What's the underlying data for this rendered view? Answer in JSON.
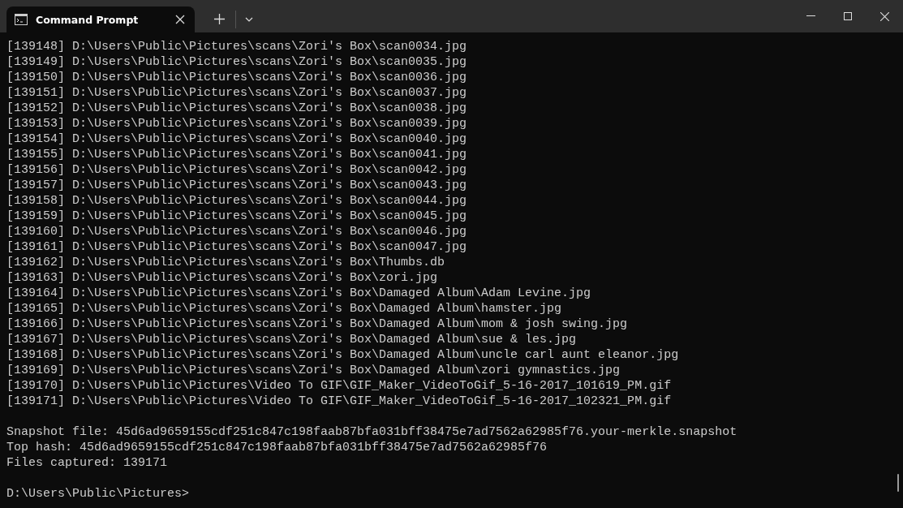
{
  "window": {
    "tabs": [
      {
        "title": "Command Prompt",
        "selected": true
      }
    ]
  },
  "terminal": {
    "listing": [
      "[139148] D:\\Users\\Public\\Pictures\\scans\\Zori's Box\\scan0034.jpg",
      "[139149] D:\\Users\\Public\\Pictures\\scans\\Zori's Box\\scan0035.jpg",
      "[139150] D:\\Users\\Public\\Pictures\\scans\\Zori's Box\\scan0036.jpg",
      "[139151] D:\\Users\\Public\\Pictures\\scans\\Zori's Box\\scan0037.jpg",
      "[139152] D:\\Users\\Public\\Pictures\\scans\\Zori's Box\\scan0038.jpg",
      "[139153] D:\\Users\\Public\\Pictures\\scans\\Zori's Box\\scan0039.jpg",
      "[139154] D:\\Users\\Public\\Pictures\\scans\\Zori's Box\\scan0040.jpg",
      "[139155] D:\\Users\\Public\\Pictures\\scans\\Zori's Box\\scan0041.jpg",
      "[139156] D:\\Users\\Public\\Pictures\\scans\\Zori's Box\\scan0042.jpg",
      "[139157] D:\\Users\\Public\\Pictures\\scans\\Zori's Box\\scan0043.jpg",
      "[139158] D:\\Users\\Public\\Pictures\\scans\\Zori's Box\\scan0044.jpg",
      "[139159] D:\\Users\\Public\\Pictures\\scans\\Zori's Box\\scan0045.jpg",
      "[139160] D:\\Users\\Public\\Pictures\\scans\\Zori's Box\\scan0046.jpg",
      "[139161] D:\\Users\\Public\\Pictures\\scans\\Zori's Box\\scan0047.jpg",
      "[139162] D:\\Users\\Public\\Pictures\\scans\\Zori's Box\\Thumbs.db",
      "[139163] D:\\Users\\Public\\Pictures\\scans\\Zori's Box\\zori.jpg",
      "[139164] D:\\Users\\Public\\Pictures\\scans\\Zori's Box\\Damaged Album\\Adam Levine.jpg",
      "[139165] D:\\Users\\Public\\Pictures\\scans\\Zori's Box\\Damaged Album\\hamster.jpg",
      "[139166] D:\\Users\\Public\\Pictures\\scans\\Zori's Box\\Damaged Album\\mom & josh swing.jpg",
      "[139167] D:\\Users\\Public\\Pictures\\scans\\Zori's Box\\Damaged Album\\sue & les.jpg",
      "[139168] D:\\Users\\Public\\Pictures\\scans\\Zori's Box\\Damaged Album\\uncle carl aunt eleanor.jpg",
      "[139169] D:\\Users\\Public\\Pictures\\scans\\Zori's Box\\Damaged Album\\zori gymnastics.jpg",
      "[139170] D:\\Users\\Public\\Pictures\\Video To GIF\\GIF_Maker_VideoToGif_5-16-2017_101619_PM.gif",
      "[139171] D:\\Users\\Public\\Pictures\\Video To GIF\\GIF_Maker_VideoToGif_5-16-2017_102321_PM.gif"
    ],
    "summary": [
      "Snapshot file: 45d6ad9659155cdf251c847c198faab87bfa031bff38475e7ad7562a62985f76.your-merkle.snapshot",
      "Top hash: 45d6ad9659155cdf251c847c198faab87bfa031bff38475e7ad7562a62985f76",
      "Files captured: 139171"
    ],
    "prompt": "D:\\Users\\Public\\Pictures>"
  }
}
